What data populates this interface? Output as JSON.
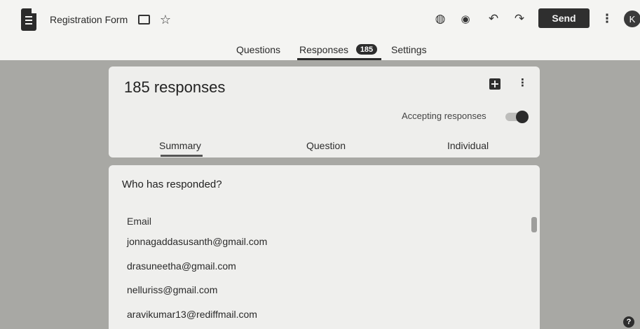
{
  "header": {
    "form_title": "Registration Form",
    "send_label": "Send",
    "avatar_initial": "K",
    "icons": [
      "form-icon",
      "folder-icon",
      "star-icon",
      "palette-icon",
      "eye-icon",
      "undo-icon",
      "redo-icon",
      "more-vert-icon"
    ]
  },
  "tabs": {
    "questions": "Questions",
    "responses": "Responses",
    "responses_count": "185",
    "settings": "Settings"
  },
  "summary_card": {
    "title": "185 responses",
    "accepting_label": "Accepting responses",
    "accepting_on": true,
    "subtabs": {
      "summary": "Summary",
      "question": "Question",
      "individual": "Individual"
    }
  },
  "responded_card": {
    "heading": "Who has responded?",
    "column_header": "Email",
    "emails": [
      "jonnagaddasusanth@gmail.com",
      "drasuneetha@gmail.com",
      "nelluriss@gmail.com",
      "aravikumar13@rediffmail.com"
    ]
  },
  "colors": {
    "background": "#a8a8a4",
    "card": "#eeeeec",
    "accent": "#2b2b2b"
  }
}
